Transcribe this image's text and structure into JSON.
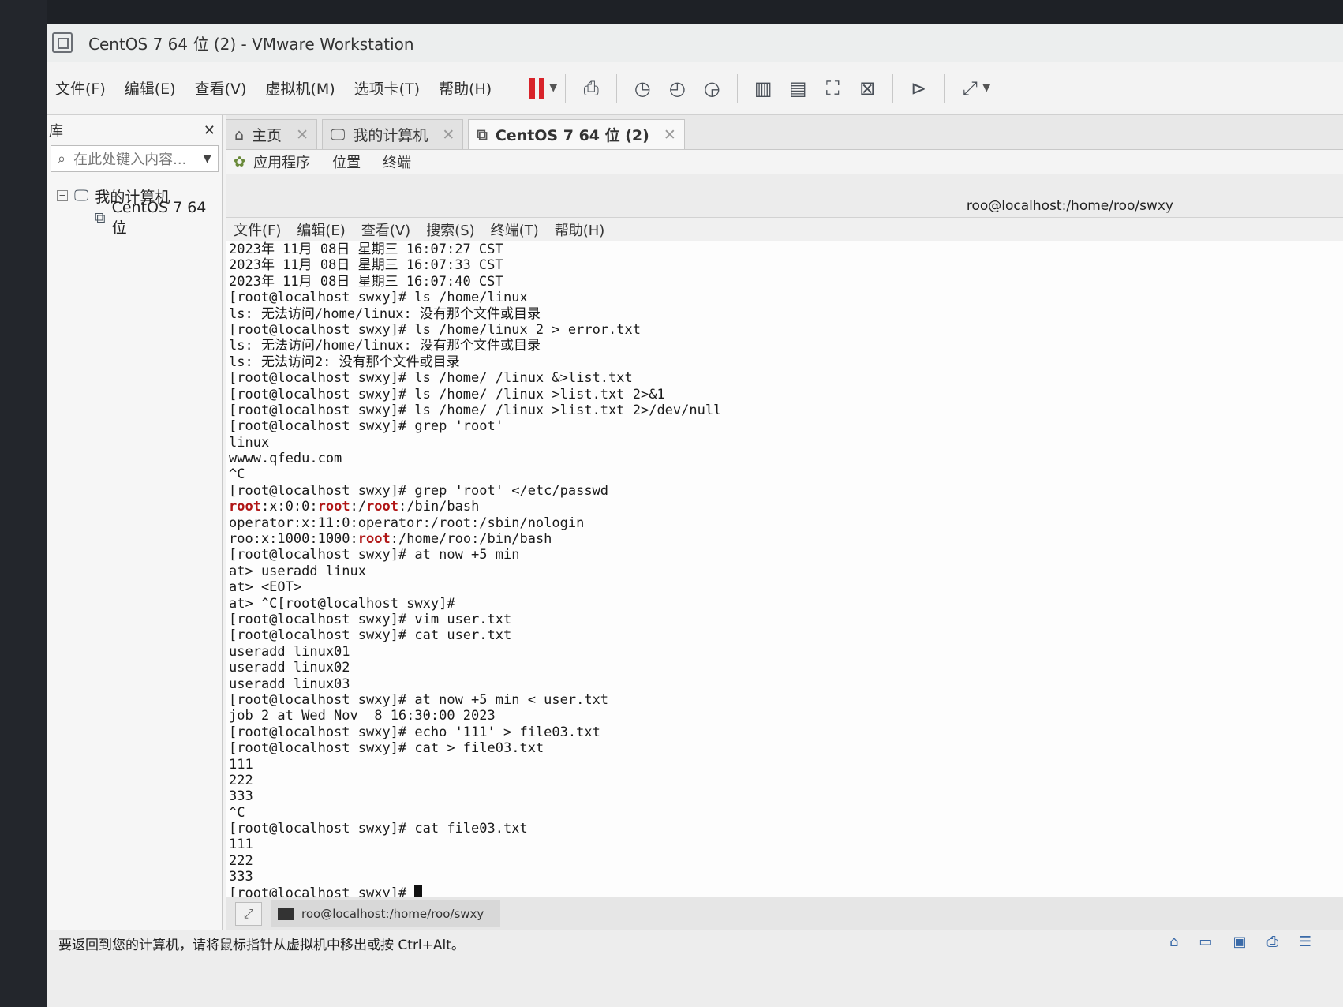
{
  "window": {
    "title": "CentOS 7 64 位 (2) - VMware Workstation"
  },
  "menubar": {
    "items": [
      "文件(F)",
      "编辑(E)",
      "查看(V)",
      "虚拟机(M)",
      "选项卡(T)",
      "帮助(H)"
    ]
  },
  "library": {
    "title": "库",
    "close": "✕",
    "search_placeholder": "在此处键入内容...",
    "tree": {
      "root": "我的计算机",
      "child": "CentOS 7 64 位"
    }
  },
  "tabs": [
    {
      "label": "主页",
      "icon": "home-icon"
    },
    {
      "label": "我的计算机",
      "icon": "monitor-icon"
    },
    {
      "label": "CentOS 7 64 位 (2)",
      "icon": "vm-icon",
      "active": true
    }
  ],
  "gnome": {
    "applications": "应用程序",
    "places": "位置",
    "terminal": "终端"
  },
  "terminal": {
    "title": "roo@localhost:/home/roo/swxy",
    "menu": [
      "文件(F)",
      "编辑(E)",
      "查看(V)",
      "搜索(S)",
      "终端(T)",
      "帮助(H)"
    ],
    "lines": [
      "2023年 11月 08日 星期三 16:07:27 CST",
      "2023年 11月 08日 星期三 16:07:33 CST",
      "2023年 11月 08日 星期三 16:07:40 CST",
      "[root@localhost swxy]# ls /home/linux",
      "ls: 无法访问/home/linux: 没有那个文件或目录",
      "[root@localhost swxy]# ls /home/linux 2 > error.txt",
      "ls: 无法访问/home/linux: 没有那个文件或目录",
      "ls: 无法访问2: 没有那个文件或目录",
      "[root@localhost swxy]# ls /home/ /linux &>list.txt",
      "[root@localhost swxy]# ls /home/ /linux >list.txt 2>&1",
      "[root@localhost swxy]# ls /home/ /linux >list.txt 2>/dev/null",
      "[root@localhost swxy]# grep 'root'",
      "linux",
      "wwww.qfedu.com",
      "^C",
      "[root@localhost swxy]# grep 'root' </etc/passwd",
      "root:x:0:0:root:/root:/bin/bash",
      "operator:x:11:0:operator:/root:/sbin/nologin",
      "roo:x:1000:1000:root:/home/roo:/bin/bash",
      "[root@localhost swxy]# at now +5 min",
      "at> useradd linux",
      "at> <EOT>",
      "at> ^C[root@localhost swxy]#",
      "[root@localhost swxy]# vim user.txt",
      "[root@localhost swxy]# cat user.txt",
      "useradd linux01",
      "useradd linux02",
      "useradd linux03",
      "[root@localhost swxy]# at now +5 min < user.txt",
      "job 2 at Wed Nov  8 16:30:00 2023",
      "[root@localhost swxy]# echo '111' > file03.txt",
      "[root@localhost swxy]# cat > file03.txt",
      "111",
      "222",
      "333",
      "^C",
      "[root@localhost swxy]# cat file03.txt",
      "111",
      "222",
      "333",
      "[root@localhost swxy]# "
    ],
    "highlight_word": "root",
    "highlight_color": "#b01515"
  },
  "vm_taskbar": {
    "item": "roo@localhost:/home/roo/swxy"
  },
  "status": {
    "message": "要返回到您的计算机，请将鼠标指针从虚拟机中移出或按 Ctrl+Alt。"
  },
  "colors": {
    "pause_red": "#d8232a"
  }
}
